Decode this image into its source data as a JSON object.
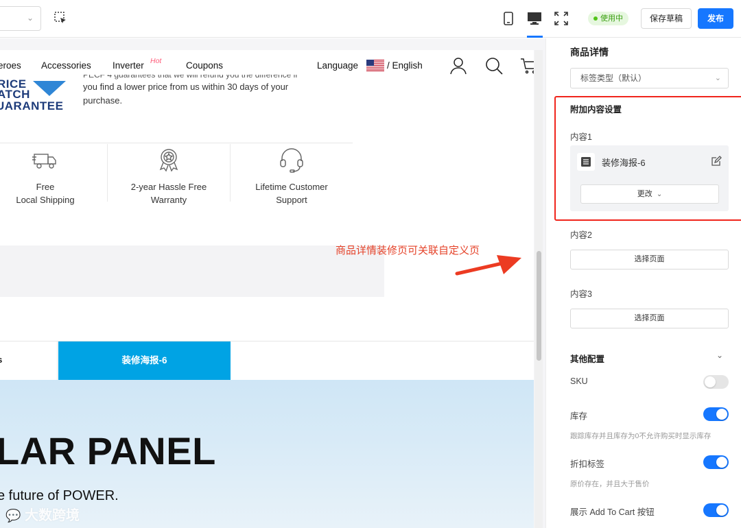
{
  "toolbar": {
    "status": "使用中",
    "save_draft": "保存草稿",
    "publish": "发布"
  },
  "storefront": {
    "nav": {
      "items": [
        "eroes",
        "Accessories",
        "Inverter",
        "Coupons"
      ],
      "hot_badge": "Hot",
      "language_label": "Language",
      "language_value": "/ English"
    },
    "guarantee": {
      "badge_lines": [
        "RICE",
        "ATCH",
        "UARANTEE"
      ],
      "text_line0": "PECF 4 guarantees that we will refund you the difference if",
      "text_line1": "you find a lower price from us within 30 days of your",
      "text_line2": "purchase."
    },
    "features": [
      {
        "label": "Free\nLocal Shipping"
      },
      {
        "label": "2-year Hassle Free\nWarranty"
      },
      {
        "label": "Lifetime Customer\nSupport"
      }
    ],
    "tabs": {
      "partial_tab": "ws",
      "active_tab": "装修海报-6"
    },
    "hero": {
      "title": "LAR PANEL",
      "subtitle": "e future of POWER."
    }
  },
  "annotation": {
    "text": "商品详情装修页可关联自定义页",
    "color": "#e5432a"
  },
  "watermark": "大数跨境",
  "panel": {
    "title": "商品详情",
    "tag_select": "标签类型（默认）",
    "additional_title": "附加内容设置",
    "content1_label": "内容1",
    "content1_name": "装修海报-6",
    "content1_change": "更改",
    "content2_label": "内容2",
    "content2_button": "选择页面",
    "content3_label": "内容3",
    "content3_button": "选择页面",
    "other_title": "其他配置",
    "sku_label": "SKU",
    "sku_on": false,
    "stock_label": "库存",
    "stock_on": true,
    "stock_hint": "跟踪库存并且库存为0不允许购买时显示库存",
    "discount_label": "折扣标签",
    "discount_on": true,
    "discount_hint": "原价存在，并且大于售价",
    "add_to_cart_label": "展示 Add To Cart 按钮",
    "add_to_cart_on": true
  },
  "colors": {
    "primary": "#1677ff",
    "active_tab": "#00a3e4",
    "highlight_border": "#f0241b"
  }
}
